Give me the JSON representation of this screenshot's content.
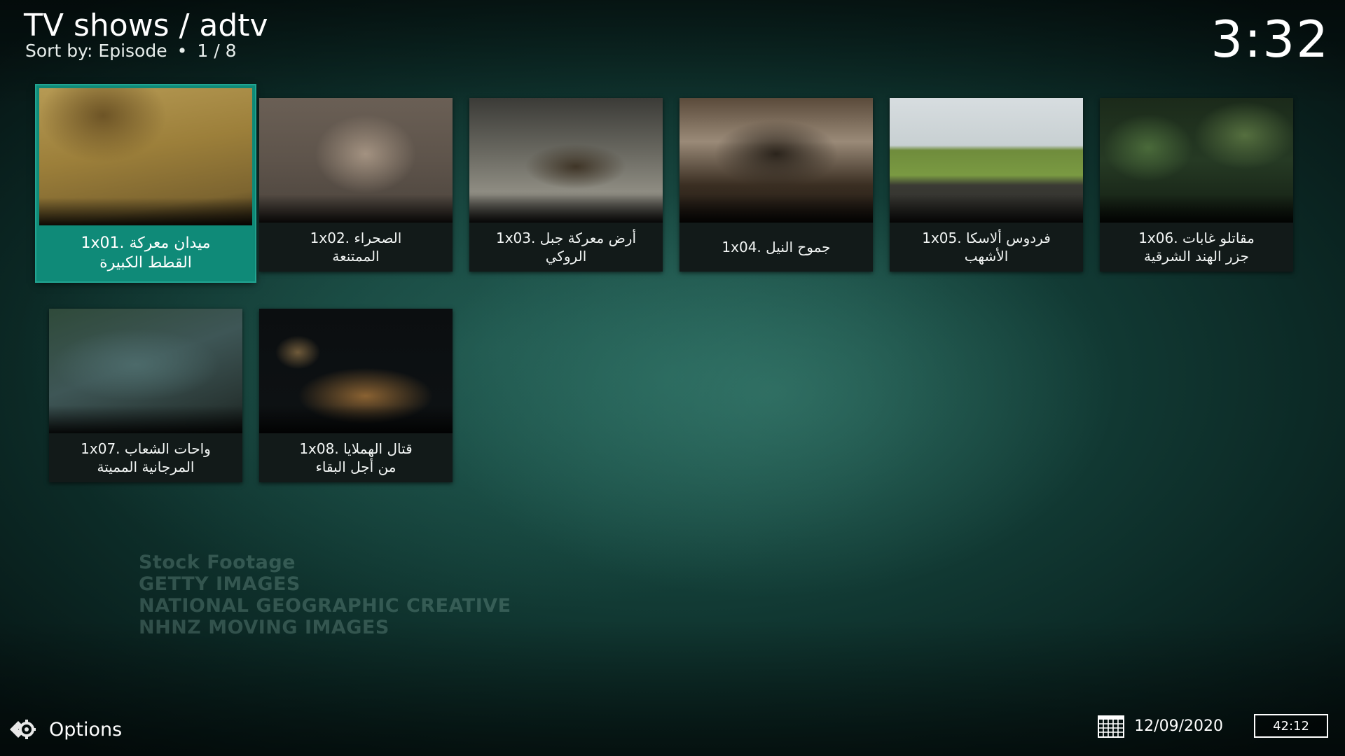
{
  "header": {
    "title": "TV shows / adtv",
    "sort_label": "Sort by: Episode",
    "separator": "•",
    "position": "1 / 8"
  },
  "clock": "3:32",
  "episodes": [
    {
      "number": "1x01.",
      "title_line1": "ميدان معركة",
      "title_line2": "القطط الكبيرة",
      "focused": true
    },
    {
      "number": "1x02.",
      "title_line1": "الصحراء",
      "title_line2": "الممتنعة"
    },
    {
      "number": "1x03.",
      "title_line1": "أرض معركة جبل",
      "title_line2": "الروكي"
    },
    {
      "number": "1x04.",
      "title_line1": "جموح النيل",
      "title_line2": ""
    },
    {
      "number": "1x05.",
      "title_line1": "فردوس ألاسكا",
      "title_line2": "الأشهب"
    },
    {
      "number": "1x06.",
      "title_line1": "مقاتلو غابات",
      "title_line2": "جزر الهند الشرقية"
    },
    {
      "number": "1x07.",
      "title_line1": "واحات الشعاب",
      "title_line2": "المرجانية المميتة"
    },
    {
      "number": "1x08.",
      "title_line1": "قتال الهملايا",
      "title_line2": "من أجل البقاء"
    }
  ],
  "watermark": [
    "Stock Footage",
    "GETTY IMAGES",
    "NATIONAL GEOGRAPHIC CREATIVE",
    "NHNZ MOVING IMAGES"
  ],
  "footer": {
    "options_label": "Options",
    "date": "12/09/2020",
    "time_box": "42:12"
  },
  "colors": {
    "focus_accent": "#0f8a78",
    "background": "#1d5a50"
  }
}
